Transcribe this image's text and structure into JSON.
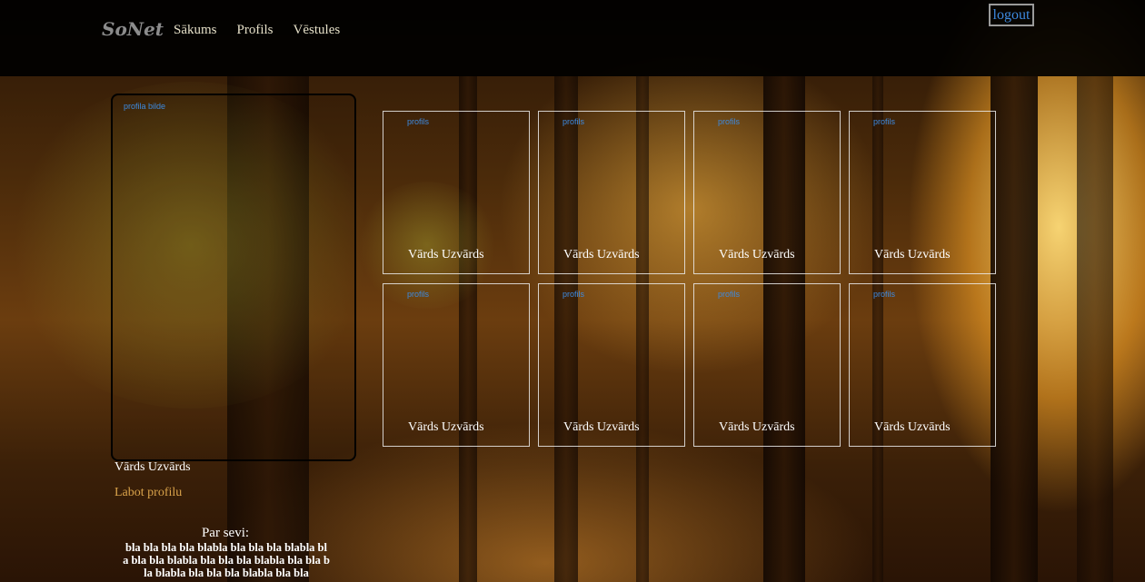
{
  "header": {
    "logo": "SoNet",
    "nav": [
      "Sākums",
      "Profils",
      "Vēstules"
    ],
    "logout": "logout"
  },
  "profile": {
    "photo_label": "profila bilde",
    "name": "Vārds Uzvārds",
    "edit_link": "Labot profilu",
    "about_title": "Par sevi:",
    "about_text": "bla bla bla bla blabla bla bla bla blabla bla bla bla blabla bla bla bla blabla bla bla bla blabla bla bla bla blabla bla bla"
  },
  "friends": [
    {
      "label": "profils",
      "name": "Vārds Uzvārds"
    },
    {
      "label": "profils",
      "name": "Vārds Uzvārds"
    },
    {
      "label": "profils",
      "name": "Vārds Uzvārds"
    },
    {
      "label": "profils",
      "name": "Vārds Uzvārds"
    },
    {
      "label": "profils",
      "name": "Vārds Uzvārds"
    },
    {
      "label": "profils",
      "name": "Vārds Uzvārds"
    },
    {
      "label": "profils",
      "name": "Vārds Uzvārds"
    },
    {
      "label": "profils",
      "name": "Vārds Uzvārds"
    }
  ],
  "colors": {
    "link_blue": "#3d8ae0",
    "edit_link": "#d9a24a",
    "topbar": "#000000"
  }
}
